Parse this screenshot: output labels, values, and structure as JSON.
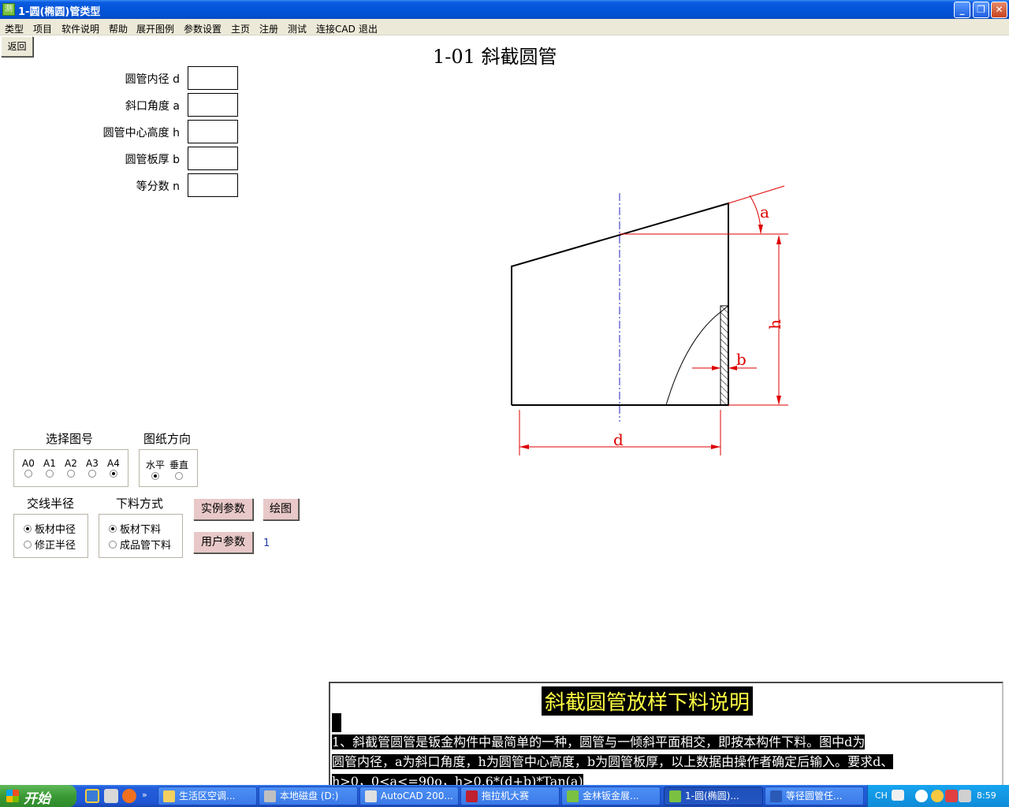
{
  "window": {
    "title": "1-圆(椭圆)管类型",
    "min": "_",
    "restore": "❐",
    "close": "✕"
  },
  "menu": [
    "类型",
    "项目",
    "软件说明",
    "帮助",
    "展开图例",
    "参数设置",
    "主页",
    "注册",
    "测试",
    "连接CAD",
    "退出"
  ],
  "back_label": "返回",
  "page_title": "1-01 斜截圆管",
  "params": [
    {
      "label": "圆管内径 d",
      "value": ""
    },
    {
      "label": "斜口角度 a",
      "value": ""
    },
    {
      "label": "圆管中心高度 h",
      "value": ""
    },
    {
      "label": "圆管板厚 b",
      "value": ""
    },
    {
      "label": "等分数 n",
      "value": ""
    }
  ],
  "paper_size": {
    "title": "选择图号",
    "options": [
      "A0",
      "A1",
      "A2",
      "A3",
      "A4"
    ],
    "selected": "A4"
  },
  "orientation": {
    "title": "图纸方向",
    "options": [
      "水平",
      "垂直"
    ],
    "selected": "水平"
  },
  "intersect_radius": {
    "title": "交线半径",
    "options": [
      "板材中径",
      "修正半径"
    ],
    "selected": "板材中径"
  },
  "cutting_mode": {
    "title": "下料方式",
    "options": [
      "板材下料",
      "成品管下料"
    ],
    "selected": "板材下料"
  },
  "buttons": {
    "example": "实例参数",
    "draw": "绘图",
    "user": "用户参数"
  },
  "user_count": "1",
  "drawing_labels": {
    "a": "a",
    "h": "h",
    "b": "b",
    "d": "d"
  },
  "description": {
    "title": "斜截圆管放样下料说明",
    "lines": [
      "    1、斜截管圆管是钣金构件中最简单的一种，圆管与一倾斜平面相交，即按本构件下料。图中d为",
      "圆管内径，a为斜口角度，h为圆管中心高度，b为圆管板厚，以上数据由操作者确定后输入。要求d、",
      "h>0，0<a<=90o，h>0.6*(d+b)*Tan(a)"
    ]
  },
  "taskbar": {
    "start": "开始",
    "tasks": [
      "生活区空调...",
      "本地磁盘 (D:)",
      "AutoCAD 200...",
      "拖拉机大赛",
      "金林钣金展...",
      "1-圆(椭圆)...",
      "等径圆管任..."
    ],
    "active": "1-圆(椭圆)...",
    "lang": "CH",
    "clock": "8:59"
  }
}
